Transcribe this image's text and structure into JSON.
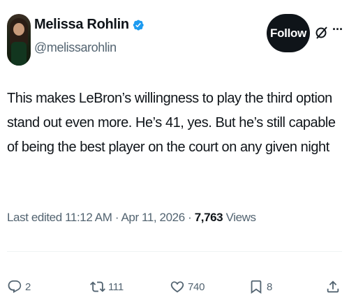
{
  "author": {
    "name": "Melissa Rohlin",
    "handle": "@melissarohlin"
  },
  "header": {
    "follow_label": "Follow",
    "more_label": "···"
  },
  "tweet": {
    "text": "This makes LeBron’s willingness to play the third option stand out even more. He’s 41, yes. But he’s still capable of being the best player on the court on any given night"
  },
  "meta": {
    "edited_prefix": "Last edited",
    "time": "11:12 AM",
    "separator": "·",
    "date": "Apr 11, 2026",
    "views_count": "7,763",
    "views_label": "Views"
  },
  "actions": {
    "replies": "2",
    "reposts": "111",
    "likes": "740",
    "bookmarks": "8"
  },
  "colors": {
    "text": "#0f1419",
    "secondary": "#536471",
    "verified": "#1d9bf0",
    "button": "#0f1419"
  },
  "icons": [
    "verified-badge-icon",
    "grok-icon",
    "more-icon",
    "reply-icon",
    "repost-icon",
    "like-icon",
    "bookmark-icon",
    "share-icon"
  ]
}
